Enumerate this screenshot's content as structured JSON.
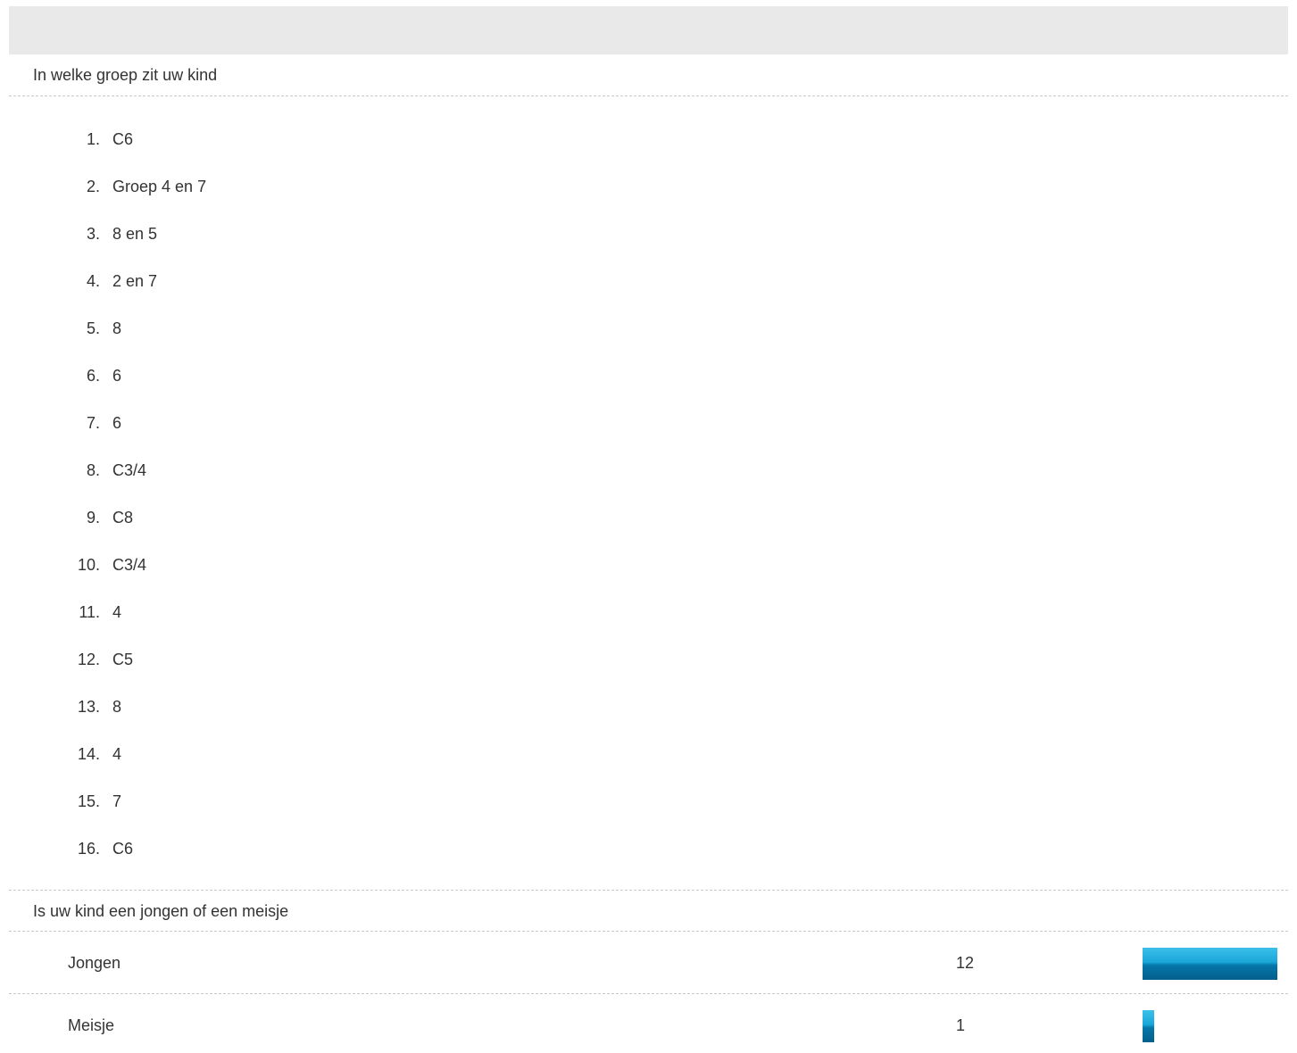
{
  "questions": {
    "group": {
      "title": "In welke groep zit uw kind",
      "answers": [
        {
          "num": "1.",
          "text": "C6"
        },
        {
          "num": "2.",
          "text": "Groep 4 en 7"
        },
        {
          "num": "3.",
          "text": "8 en 5"
        },
        {
          "num": "4.",
          "text": "2 en 7"
        },
        {
          "num": "5.",
          "text": "8"
        },
        {
          "num": "6.",
          "text": "6"
        },
        {
          "num": "7.",
          "text": "6"
        },
        {
          "num": "8.",
          "text": "C3/4"
        },
        {
          "num": "9.",
          "text": "C8"
        },
        {
          "num": "10.",
          "text": "C3/4"
        },
        {
          "num": "11.",
          "text": "4"
        },
        {
          "num": "12.",
          "text": "C5"
        },
        {
          "num": "13.",
          "text": "8"
        },
        {
          "num": "14.",
          "text": "4"
        },
        {
          "num": "15.",
          "text": "7"
        },
        {
          "num": "16.",
          "text": "C6"
        }
      ]
    },
    "gender": {
      "title": "Is uw kind een jongen of een meisje",
      "choices": [
        {
          "label": "Jongen",
          "count": "12",
          "share": 1.0
        },
        {
          "label": "Meisje",
          "count": "1",
          "share": 0.0833
        }
      ],
      "bar_color": "#1aa3d6"
    }
  }
}
